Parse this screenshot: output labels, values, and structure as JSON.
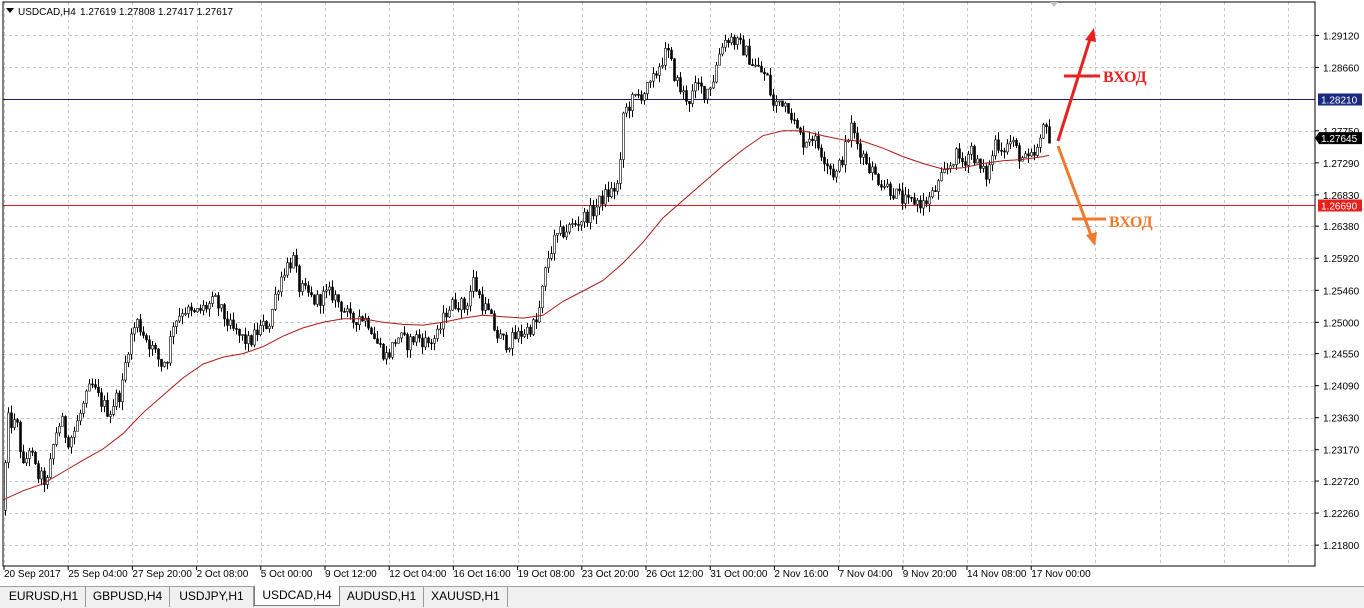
{
  "window": {
    "header_symbol": "USDCAD,H4",
    "header_ohlc": "1.27619 1.27808 1.27417 1.27617"
  },
  "tabs": [
    {
      "label": "EURUSD,H1",
      "active": false
    },
    {
      "label": "GBPUSD,H4",
      "active": false
    },
    {
      "label": "USDJPY,H1",
      "active": false
    },
    {
      "label": "USDCAD,H4",
      "active": true
    },
    {
      "label": "AUDUSD,H1",
      "active": false
    },
    {
      "label": "XAUUSD,H1",
      "active": false
    }
  ],
  "chart_data": {
    "type": "candlestick",
    "symbol": "USDCAD",
    "timeframe": "H4",
    "ylim": [
      1.215,
      1.296
    ],
    "y_ticks": [
      "1.29120",
      "1.28660",
      "1.27750",
      "1.27290",
      "1.26830",
      "1.26380",
      "1.25920",
      "1.25460",
      "1.25000",
      "1.24550",
      "1.24090",
      "1.23630",
      "1.23170",
      "1.22720",
      "1.22260",
      "1.21800"
    ],
    "x_ticks": [
      "20 Sep 2017",
      "25 Sep 04:00",
      "27 Sep 20:00",
      "2 Oct 08:00",
      "5 Oct 00:00",
      "9 Oct 12:00",
      "12 Oct 04:00",
      "16 Oct 16:00",
      "19 Oct 08:00",
      "23 Oct 20:00",
      "26 Oct 12:00",
      "31 Oct 00:00",
      "2 Nov 16:00",
      "7 Nov 04:00",
      "9 Nov 20:00",
      "14 Nov 08:00",
      "17 Nov 00:00"
    ],
    "grid": true,
    "price_anchors": [
      [
        0,
        1.223
      ],
      [
        4,
        1.236
      ],
      [
        14,
        1.235
      ],
      [
        20,
        1.229
      ],
      [
        26,
        1.232
      ],
      [
        34,
        1.228
      ],
      [
        44,
        1.227
      ],
      [
        52,
        1.234
      ],
      [
        58,
        1.236
      ],
      [
        64,
        1.233
      ],
      [
        70,
        1.234
      ],
      [
        80,
        1.238
      ],
      [
        88,
        1.241
      ],
      [
        96,
        1.239
      ],
      [
        106,
        1.237
      ],
      [
        112,
        1.239
      ],
      [
        118,
        1.24
      ],
      [
        124,
        1.246
      ],
      [
        130,
        1.249
      ],
      [
        134,
        1.25
      ],
      [
        142,
        1.248
      ],
      [
        150,
        1.246
      ],
      [
        158,
        1.244
      ],
      [
        164,
        1.245
      ],
      [
        170,
        1.25
      ],
      [
        180,
        1.252
      ],
      [
        190,
        1.251
      ],
      [
        200,
        1.252
      ],
      [
        212,
        1.253
      ],
      [
        220,
        1.251
      ],
      [
        228,
        1.249
      ],
      [
        236,
        1.248
      ],
      [
        246,
        1.247
      ],
      [
        256,
        1.249
      ],
      [
        266,
        1.25
      ],
      [
        274,
        1.255
      ],
      [
        282,
        1.258
      ],
      [
        290,
        1.259
      ],
      [
        296,
        1.255
      ],
      [
        304,
        1.254
      ],
      [
        312,
        1.253
      ],
      [
        322,
        1.254
      ],
      [
        330,
        1.254
      ],
      [
        340,
        1.252
      ],
      [
        348,
        1.25
      ],
      [
        356,
        1.251
      ],
      [
        366,
        1.25
      ],
      [
        374,
        1.247
      ],
      [
        384,
        1.245
      ],
      [
        394,
        1.248
      ],
      [
        404,
        1.247
      ],
      [
        414,
        1.248
      ],
      [
        424,
        1.247
      ],
      [
        434,
        1.248
      ],
      [
        444,
        1.252
      ],
      [
        454,
        1.253
      ],
      [
        462,
        1.252
      ],
      [
        470,
        1.256
      ],
      [
        478,
        1.253
      ],
      [
        486,
        1.251
      ],
      [
        494,
        1.248
      ],
      [
        504,
        1.247
      ],
      [
        514,
        1.248
      ],
      [
        524,
        1.249
      ],
      [
        534,
        1.25
      ],
      [
        544,
        1.259
      ],
      [
        552,
        1.262
      ],
      [
        560,
        1.263
      ],
      [
        570,
        1.264
      ],
      [
        580,
        1.265
      ],
      [
        590,
        1.266
      ],
      [
        600,
        1.268
      ],
      [
        610,
        1.269
      ],
      [
        616,
        1.27
      ],
      [
        620,
        1.28
      ],
      [
        630,
        1.282
      ],
      [
        640,
        1.283
      ],
      [
        648,
        1.284
      ],
      [
        656,
        1.287
      ],
      [
        664,
        1.289
      ],
      [
        670,
        1.286
      ],
      [
        678,
        1.283
      ],
      [
        686,
        1.282
      ],
      [
        694,
        1.284
      ],
      [
        702,
        1.283
      ],
      [
        710,
        1.285
      ],
      [
        718,
        1.29
      ],
      [
        726,
        1.291
      ],
      [
        734,
        1.29
      ],
      [
        742,
        1.289
      ],
      [
        750,
        1.287
      ],
      [
        758,
        1.286
      ],
      [
        764,
        1.285
      ],
      [
        770,
        1.281
      ],
      [
        778,
        1.282
      ],
      [
        786,
        1.281
      ],
      [
        792,
        1.278
      ],
      [
        800,
        1.276
      ],
      [
        808,
        1.277
      ],
      [
        816,
        1.275
      ],
      [
        824,
        1.273
      ],
      [
        832,
        1.271
      ],
      [
        840,
        1.274
      ],
      [
        848,
        1.278
      ],
      [
        856,
        1.275
      ],
      [
        864,
        1.273
      ],
      [
        872,
        1.271
      ],
      [
        880,
        1.27
      ],
      [
        888,
        1.269
      ],
      [
        896,
        1.268
      ],
      [
        904,
        1.267
      ],
      [
        912,
        1.2675
      ],
      [
        920,
        1.267
      ],
      [
        928,
        1.268
      ],
      [
        936,
        1.27
      ],
      [
        944,
        1.272
      ],
      [
        952,
        1.274
      ],
      [
        960,
        1.273
      ],
      [
        968,
        1.275
      ],
      [
        976,
        1.272
      ],
      [
        984,
        1.271
      ],
      [
        992,
        1.276
      ],
      [
        1000,
        1.275
      ],
      [
        1008,
        1.276
      ],
      [
        1016,
        1.274
      ],
      [
        1024,
        1.273
      ],
      [
        1032,
        1.274
      ],
      [
        1038,
        1.276
      ],
      [
        1042,
        1.28
      ],
      [
        1046,
        1.276
      ]
    ],
    "ma_anchors": [
      [
        0,
        1.2245
      ],
      [
        20,
        1.2258
      ],
      [
        40,
        1.2268
      ],
      [
        60,
        1.2285
      ],
      [
        80,
        1.2302
      ],
      [
        100,
        1.2318
      ],
      [
        120,
        1.234
      ],
      [
        140,
        1.237
      ],
      [
        160,
        1.2395
      ],
      [
        180,
        1.242
      ],
      [
        200,
        1.244
      ],
      [
        220,
        1.245
      ],
      [
        240,
        1.2455
      ],
      [
        260,
        1.2465
      ],
      [
        280,
        1.248
      ],
      [
        300,
        1.2492
      ],
      [
        320,
        1.25
      ],
      [
        340,
        1.2505
      ],
      [
        360,
        1.2505
      ],
      [
        380,
        1.25
      ],
      [
        400,
        1.2497
      ],
      [
        420,
        1.2496
      ],
      [
        440,
        1.25
      ],
      [
        460,
        1.2506
      ],
      [
        480,
        1.251
      ],
      [
        500,
        1.2508
      ],
      [
        520,
        1.2506
      ],
      [
        540,
        1.251
      ],
      [
        560,
        1.253
      ],
      [
        580,
        1.2545
      ],
      [
        600,
        1.256
      ],
      [
        620,
        1.2585
      ],
      [
        640,
        1.2615
      ],
      [
        660,
        1.265
      ],
      [
        680,
        1.2675
      ],
      [
        700,
        1.27
      ],
      [
        720,
        1.2725
      ],
      [
        740,
        1.2748
      ],
      [
        760,
        1.2768
      ],
      [
        780,
        1.2775
      ],
      [
        800,
        1.2775
      ],
      [
        820,
        1.2768
      ],
      [
        840,
        1.2762
      ],
      [
        860,
        1.276
      ],
      [
        880,
        1.275
      ],
      [
        900,
        1.2738
      ],
      [
        920,
        1.2728
      ],
      [
        940,
        1.272
      ],
      [
        960,
        1.2722
      ],
      [
        980,
        1.2728
      ],
      [
        1000,
        1.2732
      ],
      [
        1020,
        1.2734
      ],
      [
        1040,
        1.2738
      ],
      [
        1046,
        1.274
      ]
    ],
    "horizontal_lines": [
      {
        "price": 1.2821,
        "label": "1.28210",
        "color": "#1a1a66",
        "badge_color": "#1b2a80"
      },
      {
        "price": 1.2669,
        "label": "1.26690",
        "color": "#e8201c",
        "badge_color": "#e8201c"
      }
    ],
    "current_price": {
      "price": 1.27645,
      "label": "1.27645",
      "color": "#000000"
    },
    "annotations": [
      {
        "text": "ВХОД",
        "direction": "up",
        "color": "#e82020"
      },
      {
        "text": "ВХОД",
        "direction": "down",
        "color": "#f07a2c"
      }
    ],
    "colors": {
      "candle": "#000000",
      "ma": "#b01818",
      "grid": "#c8c8c8"
    }
  }
}
